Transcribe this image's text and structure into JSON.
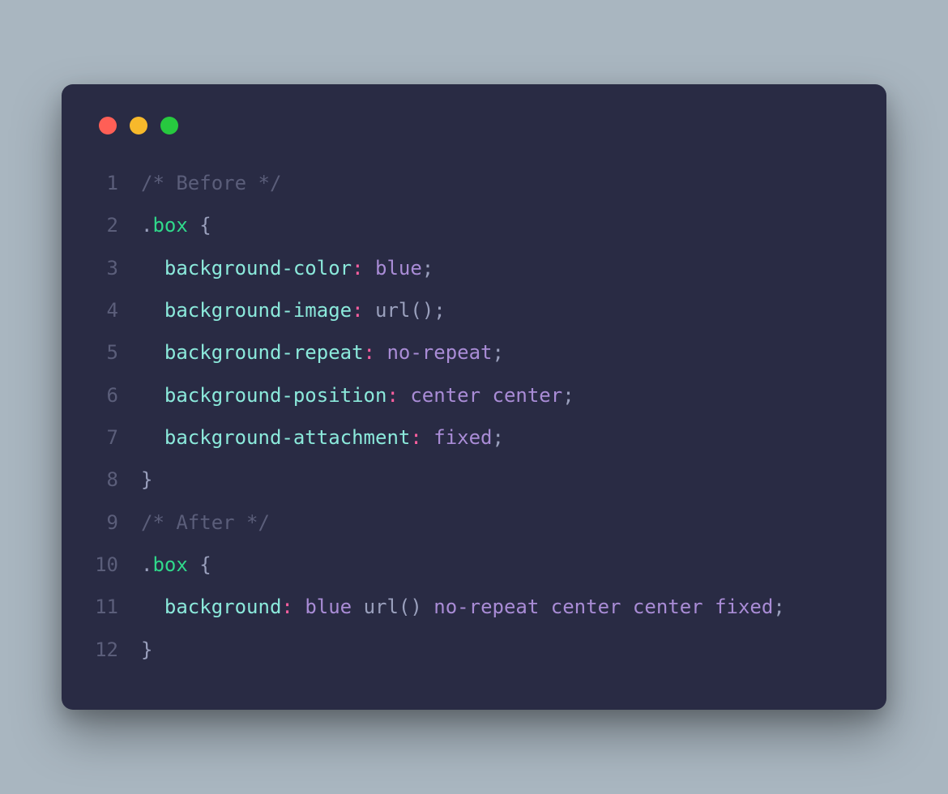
{
  "traffic": {
    "red": "#ff5f56",
    "yellow": "#f7b92b",
    "green": "#27c93f"
  },
  "theme": {
    "bg_page": "#a9b6c0",
    "bg_window": "#292b44",
    "gutter": "#5b5e7a",
    "comment": "#5b5e7a",
    "selector": "#30d98b",
    "property": "#8be9db",
    "punctuation_colon": "#ff5fa0",
    "value": "#a98cd6",
    "default_text": "#c9c9d1"
  },
  "code": {
    "lines": [
      {
        "n": "1",
        "tokens": [
          {
            "t": "/* Before */",
            "c": "tok-comment"
          }
        ]
      },
      {
        "n": "2",
        "tokens": [
          {
            "t": ".",
            "c": "tok-punct"
          },
          {
            "t": "box",
            "c": "tok-selector"
          },
          {
            "t": " ",
            "c": ""
          },
          {
            "t": "{",
            "c": "tok-brace"
          }
        ]
      },
      {
        "n": "3",
        "tokens": [
          {
            "t": "  ",
            "c": ""
          },
          {
            "t": "background-color",
            "c": "tok-prop"
          },
          {
            "t": ":",
            "c": "tok-colon"
          },
          {
            "t": " ",
            "c": ""
          },
          {
            "t": "blue",
            "c": "tok-value"
          },
          {
            "t": ";",
            "c": "tok-semi"
          }
        ]
      },
      {
        "n": "4",
        "tokens": [
          {
            "t": "  ",
            "c": ""
          },
          {
            "t": "background-image",
            "c": "tok-prop"
          },
          {
            "t": ":",
            "c": "tok-colon"
          },
          {
            "t": " ",
            "c": ""
          },
          {
            "t": "url",
            "c": "tok-func"
          },
          {
            "t": "(",
            "c": "tok-punct"
          },
          {
            "t": ")",
            "c": "tok-punct"
          },
          {
            "t": ";",
            "c": "tok-semi"
          }
        ]
      },
      {
        "n": "5",
        "tokens": [
          {
            "t": "  ",
            "c": ""
          },
          {
            "t": "background-repeat",
            "c": "tok-prop"
          },
          {
            "t": ":",
            "c": "tok-colon"
          },
          {
            "t": " ",
            "c": ""
          },
          {
            "t": "no-repeat",
            "c": "tok-value"
          },
          {
            "t": ";",
            "c": "tok-semi"
          }
        ]
      },
      {
        "n": "6",
        "tokens": [
          {
            "t": "  ",
            "c": ""
          },
          {
            "t": "background-position",
            "c": "tok-prop"
          },
          {
            "t": ":",
            "c": "tok-colon"
          },
          {
            "t": " ",
            "c": ""
          },
          {
            "t": "center center",
            "c": "tok-value"
          },
          {
            "t": ";",
            "c": "tok-semi"
          }
        ]
      },
      {
        "n": "7",
        "tokens": [
          {
            "t": "  ",
            "c": ""
          },
          {
            "t": "background-attachment",
            "c": "tok-prop"
          },
          {
            "t": ":",
            "c": "tok-colon"
          },
          {
            "t": " ",
            "c": ""
          },
          {
            "t": "fixed",
            "c": "tok-value"
          },
          {
            "t": ";",
            "c": "tok-semi"
          }
        ]
      },
      {
        "n": "8",
        "tokens": [
          {
            "t": "}",
            "c": "tok-brace"
          }
        ]
      },
      {
        "n": "9",
        "tokens": [
          {
            "t": "/* After */",
            "c": "tok-comment"
          }
        ]
      },
      {
        "n": "10",
        "tokens": [
          {
            "t": ".",
            "c": "tok-punct"
          },
          {
            "t": "box",
            "c": "tok-selector"
          },
          {
            "t": " ",
            "c": ""
          },
          {
            "t": "{",
            "c": "tok-brace"
          }
        ]
      },
      {
        "n": "11",
        "tokens": [
          {
            "t": "  ",
            "c": ""
          },
          {
            "t": "background",
            "c": "tok-prop"
          },
          {
            "t": ":",
            "c": "tok-colon"
          },
          {
            "t": " ",
            "c": ""
          },
          {
            "t": "blue",
            "c": "tok-value"
          },
          {
            "t": " ",
            "c": ""
          },
          {
            "t": "url",
            "c": "tok-func"
          },
          {
            "t": "(",
            "c": "tok-punct"
          },
          {
            "t": ")",
            "c": "tok-punct"
          },
          {
            "t": " ",
            "c": ""
          },
          {
            "t": "no-repeat center center fixed",
            "c": "tok-value"
          },
          {
            "t": ";",
            "c": "tok-semi"
          }
        ]
      },
      {
        "n": "12",
        "tokens": [
          {
            "t": "}",
            "c": "tok-brace"
          }
        ]
      }
    ]
  }
}
